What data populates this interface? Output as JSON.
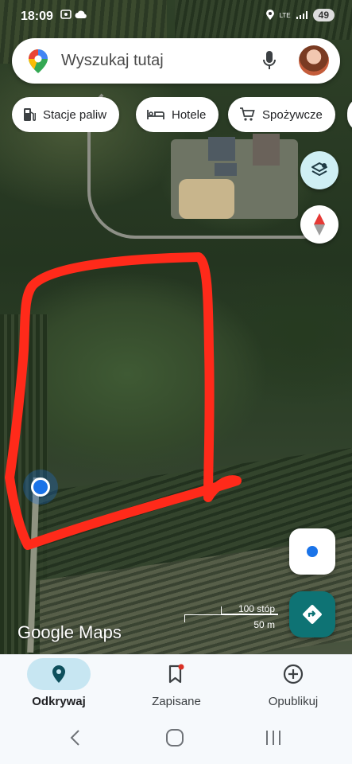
{
  "status_bar": {
    "time": "18:09",
    "left_icons": "screenshot-icon, cloud-icon",
    "network": "LTE",
    "battery": "49"
  },
  "search": {
    "placeholder": "Wyszukaj tutaj",
    "icons": [
      "maps-pin-icon",
      "mic-icon",
      "avatar"
    ]
  },
  "chips": [
    {
      "label": "Stacje paliw",
      "icon": "gas-station-icon"
    },
    {
      "label": "Hotele",
      "icon": "bed-icon"
    },
    {
      "label": "Spożywcze",
      "icon": "cart-icon"
    }
  ],
  "map": {
    "scale_top": "100 stóp",
    "scale_bottom": "50 m",
    "logo": "Google Maps"
  },
  "nav": {
    "items": [
      {
        "label": "Odkrywaj",
        "icon": "explore-pin-icon",
        "active": true
      },
      {
        "label": "Zapisane",
        "icon": "bookmark-icon",
        "active": false,
        "badge": true
      },
      {
        "label": "Opublikuj",
        "icon": "add-circle-icon",
        "active": false
      }
    ]
  },
  "colors": {
    "accent_teal": "#0e7374",
    "location_blue": "#1a73e8",
    "outline_red": "#ff2a1a",
    "active_nav_bg": "#c7e6f2"
  }
}
